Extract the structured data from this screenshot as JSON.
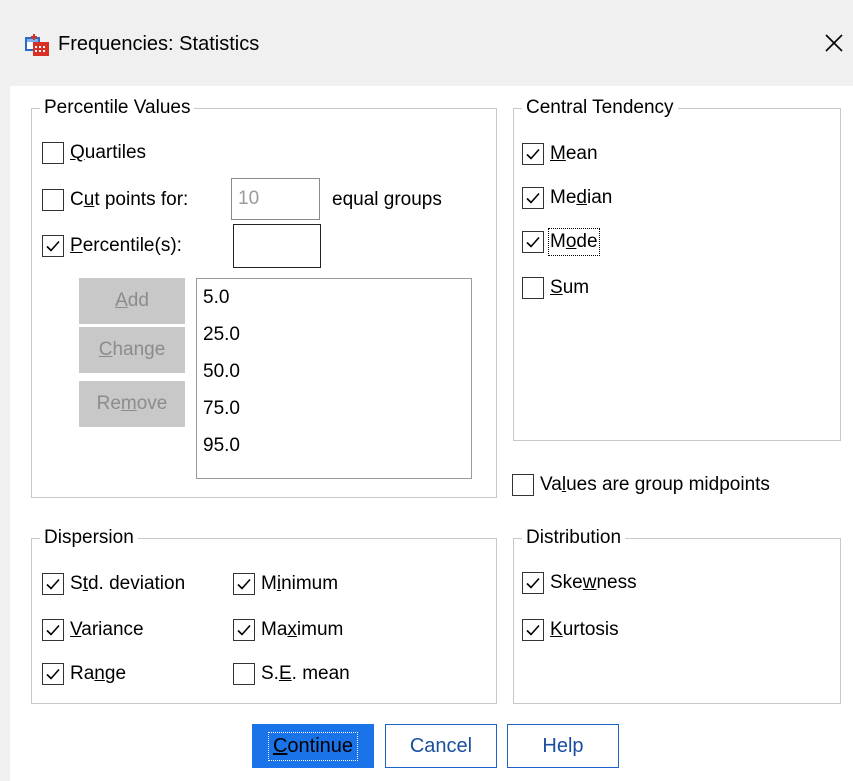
{
  "window": {
    "title": "Frequencies: Statistics",
    "icon": "frequencies-app-icon",
    "close_icon": "close-icon"
  },
  "percentile": {
    "legend": "Percentile Values",
    "quartiles": {
      "label": "Quartiles",
      "checked": false
    },
    "cut_points": {
      "label": "Cut points for:",
      "value": "10",
      "suffix": "equal groups",
      "checked": false
    },
    "percentiles": {
      "label": "Percentile(s):",
      "value": "",
      "checked": true
    },
    "buttons": {
      "add": "Add",
      "change": "Change",
      "remove": "Remove"
    },
    "list": [
      "5.0",
      "25.0",
      "50.0",
      "75.0",
      "95.0"
    ]
  },
  "central": {
    "legend": "Central Tendency",
    "mean": {
      "label": "Mean",
      "checked": true
    },
    "median": {
      "label": "Median",
      "checked": true
    },
    "mode": {
      "label": "Mode",
      "checked": true
    },
    "sum": {
      "label": "Sum",
      "checked": false
    }
  },
  "midpoints": {
    "label": "Values are group midpoints",
    "checked": false
  },
  "dispersion": {
    "legend": "Dispersion",
    "std_dev": {
      "label": "Std. deviation",
      "checked": true
    },
    "variance": {
      "label": "Variance",
      "checked": true
    },
    "range": {
      "label": "Range",
      "checked": true
    },
    "minimum": {
      "label": "Minimum",
      "checked": true
    },
    "maximum": {
      "label": "Maximum",
      "checked": true
    },
    "se_mean": {
      "label": "S.E. mean",
      "checked": false
    }
  },
  "distribution": {
    "legend": "Distribution",
    "skewness": {
      "label": "Skewness",
      "checked": true
    },
    "kurtosis": {
      "label": "Kurtosis",
      "checked": true
    }
  },
  "footer": {
    "continue": "Continue",
    "cancel": "Cancel",
    "help": "Help"
  },
  "colors": {
    "primary": "#1a73e8",
    "border": "#c8c8c8",
    "disabled_button": "#c8c8c8"
  }
}
